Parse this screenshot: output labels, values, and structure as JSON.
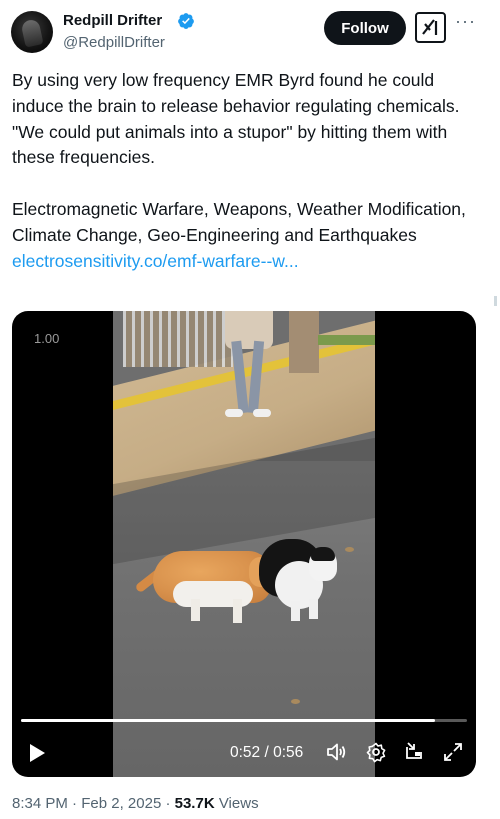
{
  "author": {
    "name": "Redpill Drifter",
    "handle": "@RedpillDrifter",
    "verified": true
  },
  "actions": {
    "follow_label": "Follow",
    "grok_icon": "grok-icon",
    "more_icon": "more-icon"
  },
  "tweet": {
    "paragraph1": "By using very low frequency EMR Byrd found he could induce the brain to release behavior regulating chemicals. \"We could put animals into a stupor\" by hitting them with these frequencies.",
    "paragraph2": "Electromagnetic Warfare, Weapons, Weather Modification, Climate Change, Geo-Engineering and Earthquakes",
    "link": "electrosensitivity.co/emf-warfare--w..."
  },
  "video": {
    "playback_speed": "1.00",
    "time": "0:52 / 0:56",
    "progress": 0.9286
  },
  "meta": {
    "time": "8:34 PM",
    "date": "Feb 2, 2025",
    "separator": "·",
    "views_count": "53.7K",
    "views_label": "Views"
  },
  "colors": {
    "link": "#1d9bf0",
    "verified": "#1d9bf0",
    "follow_bg": "#0f1419"
  }
}
